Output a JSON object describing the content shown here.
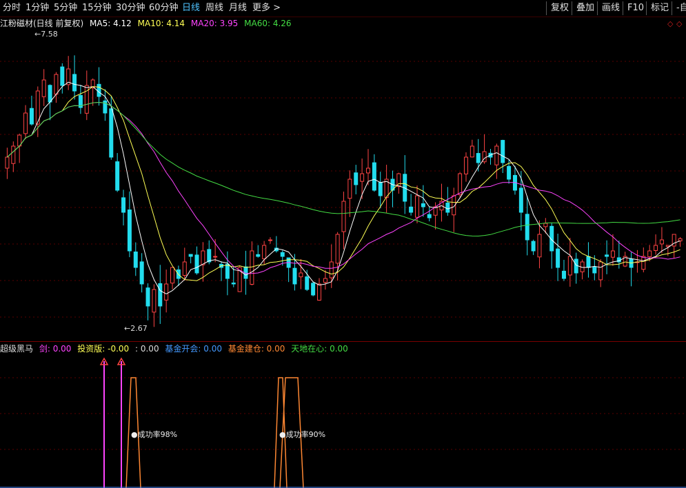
{
  "toolbar": {
    "periods": [
      "分时",
      "1分钟",
      "5分钟",
      "15分钟",
      "30分钟",
      "60分钟",
      "日线",
      "周线",
      "月线",
      "更多 >"
    ],
    "active_period": "日线",
    "actions": [
      "复权",
      "叠加",
      "画线",
      "F10",
      "标记",
      "-自"
    ]
  },
  "main_legend": {
    "title": "江粉磁材(日线 前复权)",
    "ma": [
      {
        "label": "MA5: 4.12",
        "color": "#ffffff"
      },
      {
        "label": "MA10: 4.14",
        "color": "#ffff55"
      },
      {
        "label": "MA20: 3.95",
        "color": "#ff44ff"
      },
      {
        "label": "MA60: 4.26",
        "color": "#44dd44"
      }
    ],
    "high_label": "7.58",
    "low_label": "2.67"
  },
  "indicator_legend": {
    "items": [
      {
        "label": "超级黑马",
        "color": "#dddddd"
      },
      {
        "label": "剑: 0.00",
        "color": "#ff44ff"
      },
      {
        "label": "投资版: -0.00",
        "color": "#ffff55"
      },
      {
        "label": ": 0.00",
        "color": "#dddddd"
      },
      {
        "label": "基金开会: 0.00",
        "color": "#4499ff"
      },
      {
        "label": "基金建仓: 0.00",
        "color": "#ff8833"
      },
      {
        "label": "天地在心: 0.00",
        "color": "#44dd44"
      }
    ],
    "annotations": [
      "成功率98%",
      "成功率90%"
    ]
  },
  "colors": {
    "up": "#ff4444",
    "down": "#22ddee",
    "ma5": "#ffffff",
    "ma10": "#ffff55",
    "ma20": "#ff44ff",
    "ma60": "#44dd44",
    "grid": "#5a0000",
    "signal_magenta": "#ff44ff",
    "signal_orange": "#ff8833"
  },
  "chart_data": {
    "type": "candlestick",
    "price_range": [
      2.4,
      7.9
    ],
    "high": 7.58,
    "low": 2.67,
    "last_ma": {
      "MA5": 4.12,
      "MA10": 4.14,
      "MA20": 3.95,
      "MA60": 4.26
    },
    "closes": [
      5.6,
      5.8,
      6.0,
      6.4,
      6.2,
      6.8,
      7.0,
      6.6,
      7.1,
      6.9,
      7.2,
      6.8,
      6.5,
      6.9,
      7.0,
      6.7,
      6.4,
      5.6,
      5.0,
      4.6,
      3.9,
      3.6,
      3.3,
      2.9,
      3.2,
      2.9,
      3.3,
      3.6,
      3.4,
      3.7,
      3.8,
      3.5,
      3.9,
      3.7,
      3.8,
      3.6,
      3.4,
      3.3,
      3.6,
      3.4,
      3.9,
      3.8,
      4.0,
      4.1,
      3.9,
      3.8,
      3.6,
      3.3,
      3.5,
      3.2,
      3.1,
      3.3,
      3.4,
      3.7,
      4.2,
      4.8,
      5.2,
      5.1,
      5.3,
      5.4,
      5.0,
      4.9,
      5.2,
      5.0,
      5.3,
      4.8,
      4.6,
      4.9,
      4.7,
      4.5,
      4.7,
      4.8,
      4.6,
      4.9,
      5.3,
      5.6,
      5.8,
      5.5,
      5.7,
      5.6,
      5.8,
      5.5,
      5.2,
      5.0,
      4.6,
      4.1,
      3.9,
      4.2,
      4.4,
      3.9,
      3.6,
      3.4,
      3.8,
      3.5,
      3.7,
      3.6,
      3.5,
      3.7,
      3.8,
      3.9,
      3.7,
      3.8,
      3.6,
      3.7,
      3.8,
      3.9,
      4.0,
      4.1,
      4.0,
      4.2,
      4.12
    ]
  }
}
